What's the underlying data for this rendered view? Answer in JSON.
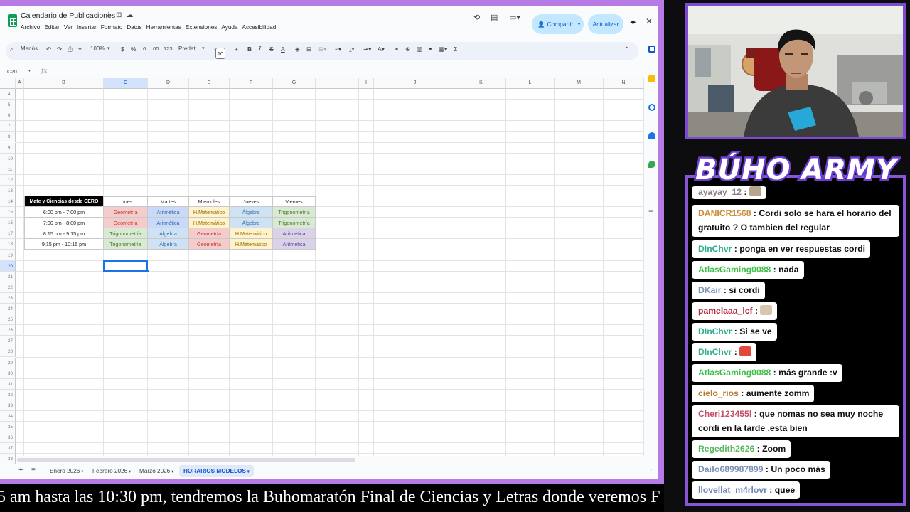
{
  "sheet": {
    "title": "Calendario de Publicaciones",
    "menu": [
      "Archivo",
      "Editar",
      "Ver",
      "Insertar",
      "Formato",
      "Datos",
      "Herramientas",
      "Extensiones",
      "Ayuda",
      "Accesibilidad"
    ],
    "share_label": "Compartir",
    "update_label": "Actualizar",
    "toolbar": {
      "search": "Menús",
      "zoom": "100%",
      "currency": "$",
      "percent": "%",
      "dec_less": ".0",
      "dec_more": ".00",
      "num_format": "123",
      "font": "Predet...",
      "font_size": "10"
    },
    "namebox": "C20",
    "fx": "fx",
    "columns": [
      "A",
      "B",
      "C",
      "D",
      "E",
      "F",
      "G",
      "H",
      "I",
      "J",
      "K",
      "L",
      "M",
      "N"
    ],
    "selected_column": "C",
    "rows_start": 4,
    "rows_end": 38,
    "selected_row": 20,
    "schedule": {
      "corner": "Mate y Ciencias desde CERO",
      "days": [
        "Lunes",
        "Martes",
        "Miércoles",
        "Jueves",
        "Viernes"
      ],
      "rows": [
        {
          "time": "6:00 pm - 7:00 pm",
          "cells": [
            "Geometría",
            "Aritmética",
            "H.Matemático",
            "Álgebra",
            "Trigonometría"
          ]
        },
        {
          "time": "7:00 pm - 8:00 pm",
          "cells": [
            "Geometría",
            "Aritmética",
            "H.Matemático",
            "Álgebra",
            "Trigonometría"
          ]
        },
        {
          "time": "8:15 pm - 9:15 pm",
          "cells": [
            "Trigonometría",
            "Álgebra",
            "Geometría",
            "H.Matemático",
            "Aritmética"
          ]
        },
        {
          "time": "9:15 pm - 10:15 pm",
          "cells": [
            "Trigonometría",
            "Álgebra",
            "Geometría",
            "H.Matemático",
            "Aritmética"
          ]
        }
      ],
      "subject_classes": {
        "Geometría": "c-geo",
        "Aritmética": "c-ari",
        "H.Matemático": "c-hmat",
        "Álgebra": "c-alg",
        "Trigonometría": "c-trig"
      }
    },
    "tabs": [
      "Enero 2026",
      "Febrero 2026",
      "Marzo 2026",
      "HORARIOS MODELOS"
    ],
    "active_tab": "HORARIOS MODELOS"
  },
  "ticker": "5 am hasta las 10:30 pm, tendremos la Buhomaratón Final de Ciencias y Letras donde veremos F",
  "brand": "BÚHO ARMY",
  "chat": [
    {
      "user": "ayayay_12",
      "color": "#8a7b85",
      "text": "",
      "emote": "#b9a58f"
    },
    {
      "user": "DANICR1568",
      "color": "#c98e3a",
      "text": "Cordi solo se hara el horario del gratuito ? O tambien del regular"
    },
    {
      "user": "DInChvr",
      "color": "#2eae8f",
      "text": "ponga en ver respuestas cordi"
    },
    {
      "user": "AtlasGaming0088",
      "color": "#3fbf4a",
      "text": "nada"
    },
    {
      "user": "DKair",
      "color": "#7c8fb8",
      "text": "si cordi"
    },
    {
      "user": "pamelaaa_lcf",
      "color": "#b3263a",
      "text": "",
      "emote": "#d7c7ae"
    },
    {
      "user": "DInChvr",
      "color": "#2eae8f",
      "text": "Si se ve"
    },
    {
      "user": "DInChvr",
      "color": "#2eae8f",
      "text": "",
      "emote": "#e04a3a"
    },
    {
      "user": "AtlasGaming0088",
      "color": "#3fbf4a",
      "text": "más grande :v"
    },
    {
      "user": "cielo_rios",
      "color": "#b57a2b",
      "text": "aumente zomm"
    },
    {
      "user": "Cheri123455l",
      "color": "#c2506b",
      "text": "que nomas no sea muy noche cordi en la tarde ,esta bien"
    },
    {
      "user": "Regedith2626",
      "color": "#58b85d",
      "text": "Zoom"
    },
    {
      "user": "Daifo689987899",
      "color": "#7c8fb8",
      "text": "Un poco más"
    },
    {
      "user": "llovellat_m4rlovr",
      "color": "#6f84b3",
      "text": "quee"
    }
  ]
}
